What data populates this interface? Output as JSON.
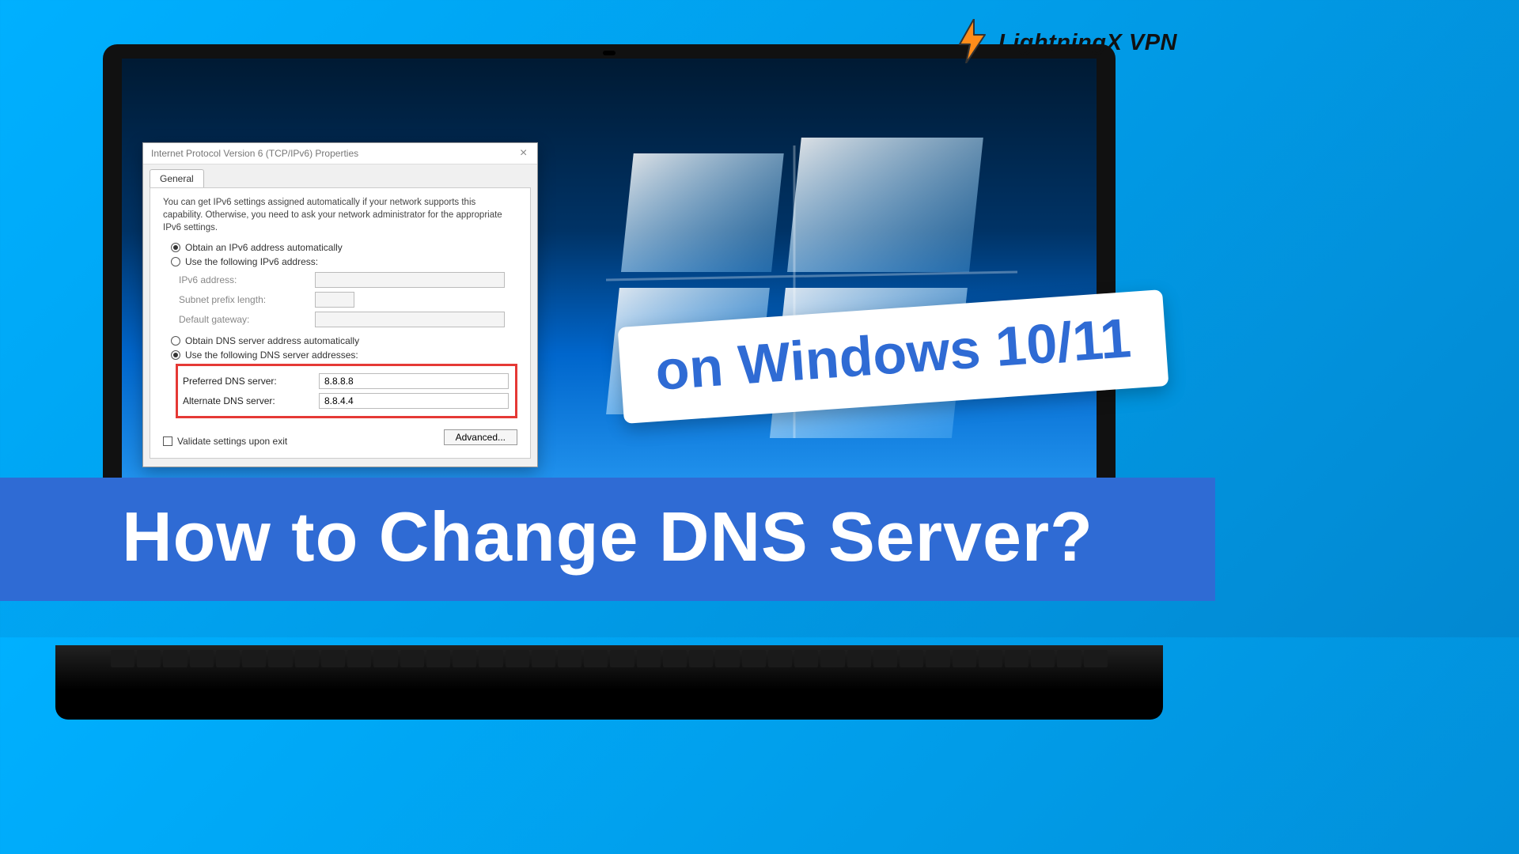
{
  "brand": {
    "name": "LightningX VPN"
  },
  "dialog": {
    "title": "Internet Protocol Version 6 (TCP/IPv6) Properties",
    "tab_general": "General",
    "intro": "You can get IPv6 settings assigned automatically if your network supports this capability. Otherwise, you need to ask your network administrator for the appropriate IPv6 settings.",
    "radio_auto_ip": "Obtain an IPv6 address automatically",
    "radio_manual_ip": "Use the following IPv6 address:",
    "label_ip": "IPv6 address:",
    "label_prefix": "Subnet prefix length:",
    "label_gateway": "Default gateway:",
    "radio_auto_dns": "Obtain DNS server address automatically",
    "radio_manual_dns": "Use the following DNS server addresses:",
    "label_pref_dns": "Preferred DNS server:",
    "label_alt_dns": "Alternate DNS server:",
    "value_pref_dns": "8.8.8.8",
    "value_alt_dns": "8.8.4.4",
    "check_validate": "Validate settings upon exit",
    "btn_advanced": "Advanced..."
  },
  "overlay": {
    "sub": "on Windows 10/11",
    "main": "How to Change DNS Server?"
  }
}
